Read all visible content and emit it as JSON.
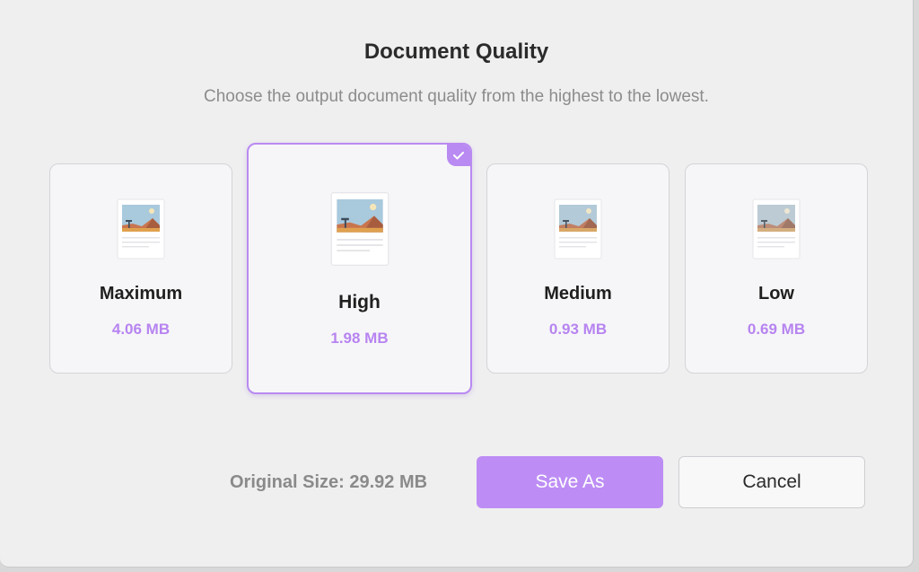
{
  "dialog": {
    "title": "Document Quality",
    "subtitle": "Choose the output document quality from the highest to the lowest."
  },
  "options": [
    {
      "label": "Maximum",
      "size": "4.06 MB",
      "selected": false
    },
    {
      "label": "High",
      "size": "1.98 MB",
      "selected": true
    },
    {
      "label": "Medium",
      "size": "0.93 MB",
      "selected": false
    },
    {
      "label": "Low",
      "size": "0.69 MB",
      "selected": false
    }
  ],
  "footer": {
    "original_size": "Original Size: 29.92 MB",
    "save_label": "Save As",
    "cancel_label": "Cancel"
  },
  "colors": {
    "accent": "#b98af2",
    "size_text": "#b784f0",
    "save_button": "#bd8df5"
  },
  "icons": {
    "document": "document-preview-icon",
    "check": "checkmark-icon"
  }
}
